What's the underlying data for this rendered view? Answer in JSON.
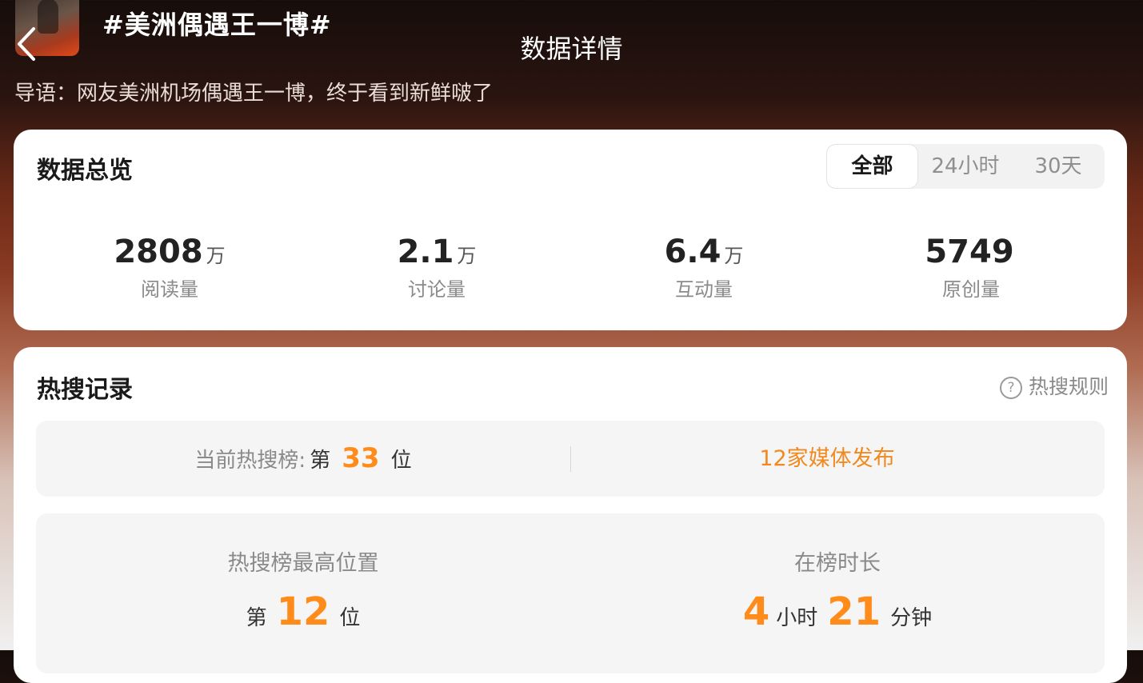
{
  "header": {
    "topic_title": "#美洲偶遇王一博#",
    "page_title": "数据详情",
    "intro": "导语：网友美洲机场偶遇王一博，终于看到新鲜啵了"
  },
  "overview": {
    "title": "数据总览",
    "tabs": [
      {
        "label": "全部",
        "active": true
      },
      {
        "label": "24小时",
        "active": false
      },
      {
        "label": "30天",
        "active": false
      }
    ],
    "stats": [
      {
        "value": "2808",
        "unit": "万",
        "label": "阅读量"
      },
      {
        "value": "2.1",
        "unit": "万",
        "label": "讨论量"
      },
      {
        "value": "6.4",
        "unit": "万",
        "label": "互动量"
      },
      {
        "value": "5749",
        "unit": "",
        "label": "原创量"
      }
    ]
  },
  "hot_search": {
    "title": "热搜记录",
    "rules_label": "热搜规则",
    "rules_icon": "question-circle-icon",
    "current_rank": {
      "prefix": "当前热搜榜:",
      "rank_prefix": "第",
      "rank": "33",
      "rank_suffix": "位"
    },
    "media": "12家媒体发布",
    "highest": {
      "label": "热搜榜最高位置",
      "rank_prefix": "第",
      "rank": "12",
      "rank_suffix": "位"
    },
    "duration": {
      "label": "在榜时长",
      "hours": "4",
      "hours_unit": "小时",
      "minutes": "21",
      "minutes_unit": "分钟"
    }
  },
  "colors": {
    "accent": "#ff8c1a",
    "media_link": "#f08a1e",
    "muted": "#8a8a8a"
  }
}
